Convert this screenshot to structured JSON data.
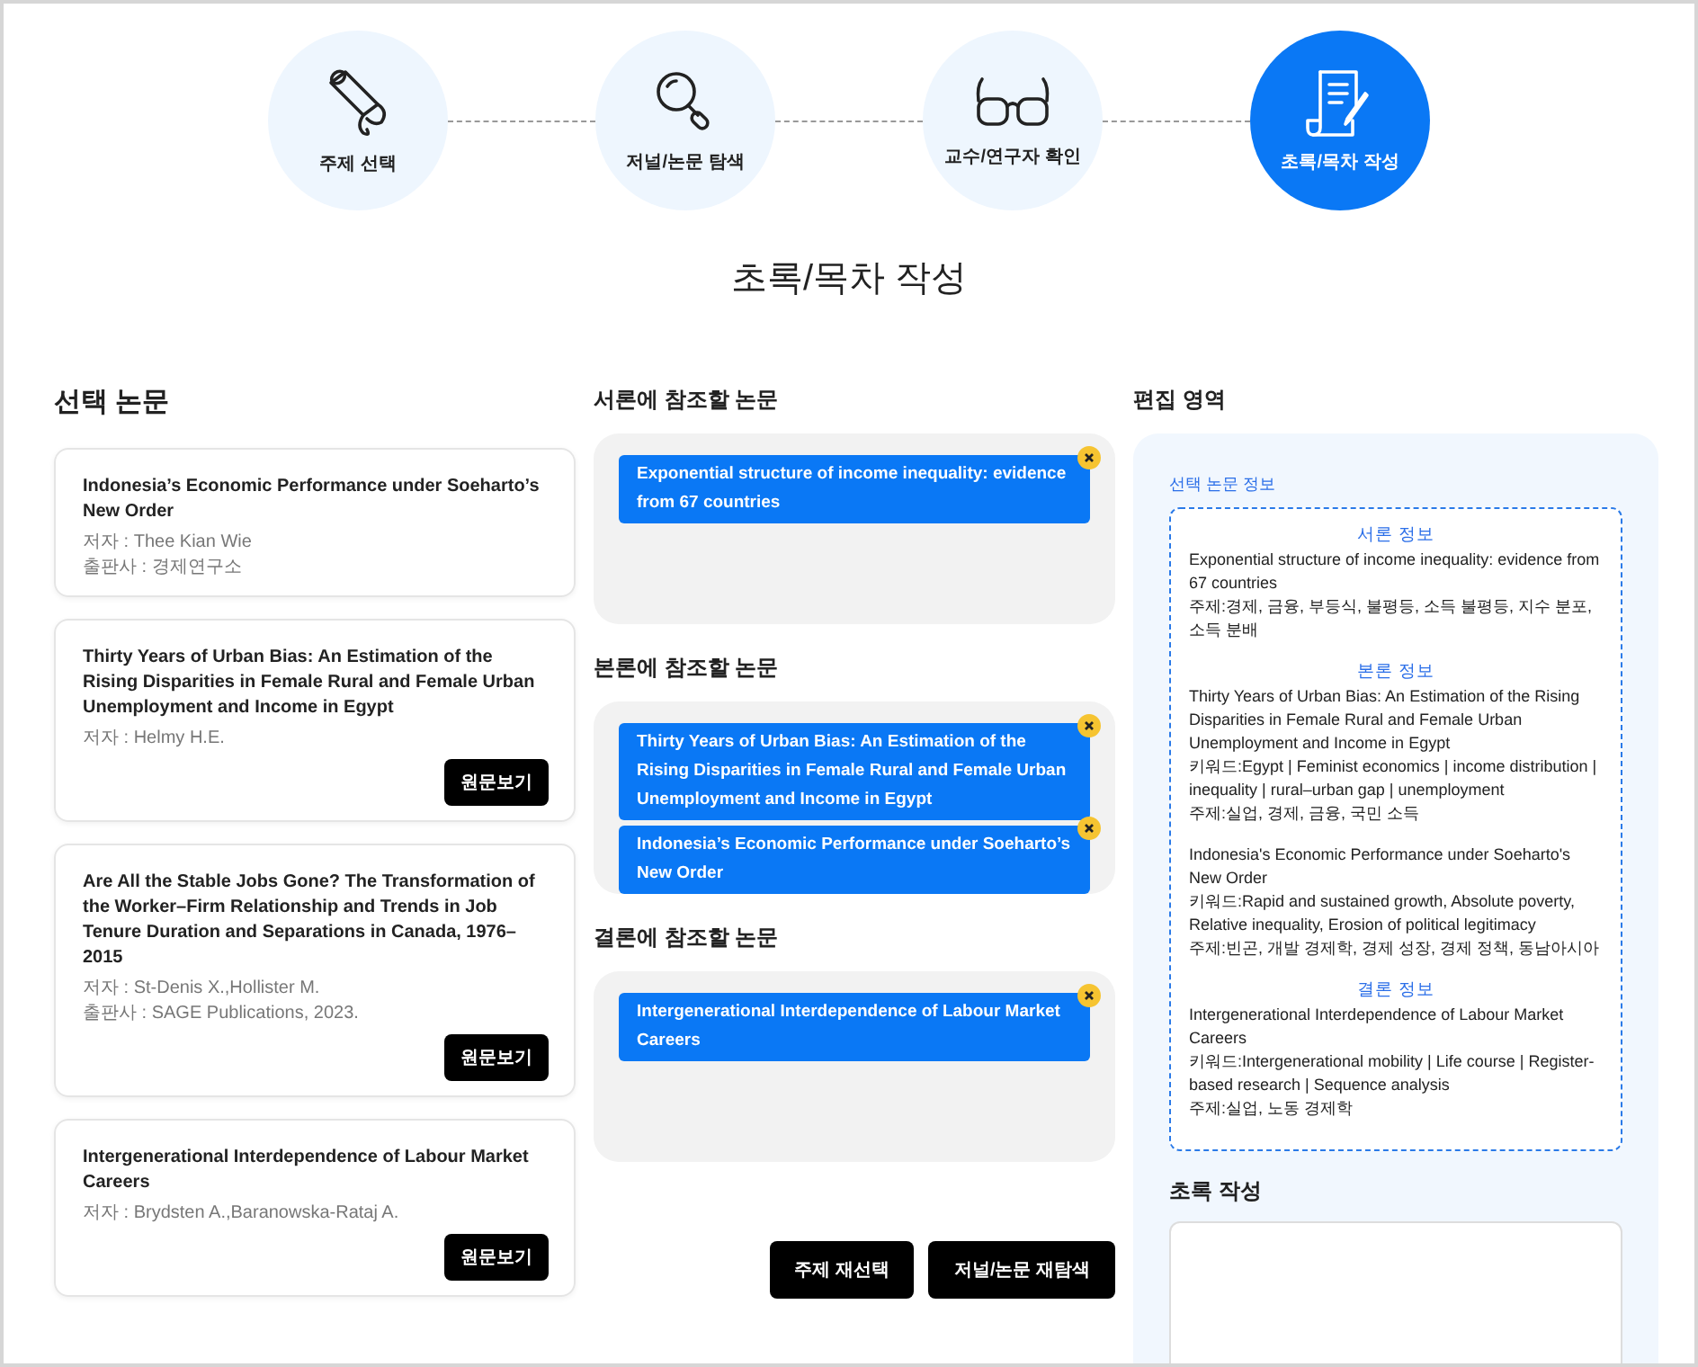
{
  "steps": [
    {
      "label": "주제 선택",
      "selected": false
    },
    {
      "label": "저널/논문 탐색",
      "selected": false
    },
    {
      "label": "교수/연구자 확인",
      "selected": false
    },
    {
      "label": "초록/목차 작성",
      "selected": true
    }
  ],
  "page_title": "초록/목차 작성",
  "selected_papers": {
    "heading": "선택 논문",
    "cards": [
      {
        "title": "Indonesia’s Economic Performance under Soeharto’s New Order",
        "author": "저자 : Thee Kian Wie",
        "publisher": "출판사 : 경제연구소"
      },
      {
        "title": "Thirty Years of Urban Bias: An Estimation of the Rising Disparities in Female Rural and Female Urban Unemployment and Income in Egypt",
        "author": "저자 : Helmy H.E.",
        "button": "원문보기"
      },
      {
        "title": "Are All the Stable Jobs Gone? The Transformation of the Worker–Firm Relationship and Trends in Job Tenure Duration and Separations in Canada, 1976–2015",
        "author": "저자 : St-Denis X.,Hollister M.",
        "publisher": "출판사 : SAGE Publications, 2023.",
        "button": "원문보기"
      },
      {
        "title": "Intergenerational Interdependence of Labour Market Careers",
        "author": "저자 : Brydsten A.,Baranowska-Rataj A.",
        "button": "원문보기"
      }
    ]
  },
  "reference_groups": [
    {
      "heading": "서론에 참조할 논문",
      "items": [
        "Exponential structure of income inequality: evidence from 67 countries"
      ]
    },
    {
      "heading": "본론에 참조할 논문",
      "items": [
        "Thirty Years of Urban Bias: An Estimation of the Rising Disparities in Female Rural and Female Urban Unemployment and Income in Egypt",
        "Indonesia’s Economic Performance under Soeharto’s New Order"
      ]
    },
    {
      "heading": "결론에 참조할 논문",
      "items": [
        "Intergenerational Interdependence of Labour Market Careers"
      ]
    }
  ],
  "actions": [
    "주제 재선택",
    "저널/논문 재탐색"
  ],
  "edit_area": {
    "heading": "편집 영역",
    "info_label": "선택 논문 정보",
    "sections": [
      {
        "heading": "서론 정보",
        "papers": [
          {
            "lines": [
              "Exponential structure of income inequality: evidence from 67 countries",
              "주제:경제, 금융, 부등식, 불평등, 소득 불평등, 지수 분포, 소득 분배"
            ]
          }
        ]
      },
      {
        "heading": "본론 정보",
        "papers": [
          {
            "lines": [
              "Thirty Years of Urban Bias: An Estimation of the Rising Disparities in Female Rural and Female Urban Unemployment and Income in Egypt",
              "키워드:Egypt | Feminist economics | income distribution | inequality | rural–urban gap | unemployment",
              "주제:실업, 경제, 금융, 국민 소득"
            ]
          },
          {
            "lines": [
              "Indonesia's Economic Performance under Soeharto's New Order",
              "키워드:Rapid and sustained growth, Absolute poverty, Relative inequality, Erosion of political legitimacy",
              "주제:빈곤, 개발 경제학, 경제 성장, 경제 정책, 동남아시아"
            ]
          }
        ]
      },
      {
        "heading": "결론 정보",
        "papers": [
          {
            "lines": [
              "Intergenerational Interdependence of Labour Market Careers",
              "키워드:Intergenerational mobility | Life course | Register-based research | Sequence analysis",
              "주제:실업, 노동 경제학"
            ]
          }
        ]
      }
    ],
    "abstract_heading": "초록 작성"
  }
}
